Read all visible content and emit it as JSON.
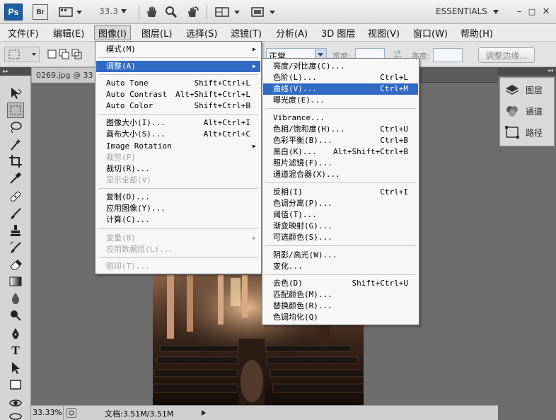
{
  "appbar": {
    "ps_label": "Ps",
    "br_label": "Br",
    "zoom": "33.3",
    "workspace": "ESSENTIALS",
    "icons": [
      "screen-mode-icon",
      "hand-icon",
      "zoom-icon",
      "rotate-view-icon",
      "arrange-documents-icon",
      "screen-mode-2-icon"
    ]
  },
  "menubar": {
    "items": [
      "文件(F)",
      "编辑(E)",
      "图像(I)",
      "图层(L)",
      "选择(S)",
      "滤镜(T)",
      "分析(A)",
      "3D 图层",
      "视图(V)",
      "窗口(W)",
      "帮助(H)"
    ],
    "active_index": 2
  },
  "options": {
    "style_value": "正常",
    "width_label": "宽度:",
    "height_label": "高度:",
    "refine_button": "调整边缘..."
  },
  "document": {
    "tab_title": "0269.jpg @ 33",
    "status_zoom": "33.33%",
    "status_doc": "文档:3.51M/3.51M"
  },
  "right_panel": {
    "items": [
      {
        "label": "图层",
        "icon": "layers-icon"
      },
      {
        "label": "通道",
        "icon": "channels-icon"
      },
      {
        "label": "路径",
        "icon": "paths-icon"
      }
    ]
  },
  "image_menu": {
    "items": [
      {
        "label": "模式(M)",
        "submenu": true
      },
      {
        "sep": true
      },
      {
        "label": "调整(A)",
        "submenu": true,
        "highlight": true
      },
      {
        "sep": true
      },
      {
        "label": "Auto Tone",
        "shortcut": "Shift+Ctrl+L"
      },
      {
        "label": "Auto Contrast",
        "shortcut": "Alt+Shift+Ctrl+L"
      },
      {
        "label": "Auto Color",
        "shortcut": "Shift+Ctrl+B"
      },
      {
        "sep": true
      },
      {
        "label": "图像大小(I)...",
        "shortcut": "Alt+Ctrl+I"
      },
      {
        "label": "画布大小(S)...",
        "shortcut": "Alt+Ctrl+C"
      },
      {
        "label": "Image Rotation",
        "submenu": true
      },
      {
        "label": "裁剪(P)",
        "disabled": true
      },
      {
        "label": "裁切(R)..."
      },
      {
        "label": "显示全部(V)",
        "disabled": true
      },
      {
        "sep": true
      },
      {
        "label": "复制(D)..."
      },
      {
        "label": "应用图像(Y)..."
      },
      {
        "label": "计算(C)..."
      },
      {
        "sep": true
      },
      {
        "label": "变量(B)",
        "submenu": true,
        "disabled": true
      },
      {
        "label": "应用数据组(L)...",
        "disabled": true
      },
      {
        "sep": true
      },
      {
        "label": "陷印(T)...",
        "disabled": true
      }
    ]
  },
  "adjust_menu": {
    "items": [
      {
        "label": "亮度/对比度(C)..."
      },
      {
        "label": "色阶(L)...",
        "shortcut": "Ctrl+L"
      },
      {
        "label": "曲线(V)...",
        "shortcut": "Ctrl+M",
        "highlight": true
      },
      {
        "label": "曝光度(E)..."
      },
      {
        "sep": true
      },
      {
        "label": "Vibrance..."
      },
      {
        "label": "色相/饱和度(H)...",
        "shortcut": "Ctrl+U"
      },
      {
        "label": "色彩平衡(B)...",
        "shortcut": "Ctrl+B"
      },
      {
        "label": "黑白(K)...",
        "shortcut": "Alt+Shift+Ctrl+B"
      },
      {
        "label": "照片滤镜(F)..."
      },
      {
        "label": "通道混合器(X)..."
      },
      {
        "sep": true
      },
      {
        "label": "反相(I)",
        "shortcut": "Ctrl+I"
      },
      {
        "label": "色调分离(P)..."
      },
      {
        "label": "阈值(T)..."
      },
      {
        "label": "渐变映射(G)..."
      },
      {
        "label": "可选颜色(S)..."
      },
      {
        "sep": true
      },
      {
        "label": "阴影/高光(W)..."
      },
      {
        "label": "变化..."
      },
      {
        "sep": true
      },
      {
        "label": "去色(D)",
        "shortcut": "Shift+Ctrl+U"
      },
      {
        "label": "匹配颜色(M)..."
      },
      {
        "label": "替换颜色(R)..."
      },
      {
        "label": "色调均化(Q)"
      }
    ]
  }
}
